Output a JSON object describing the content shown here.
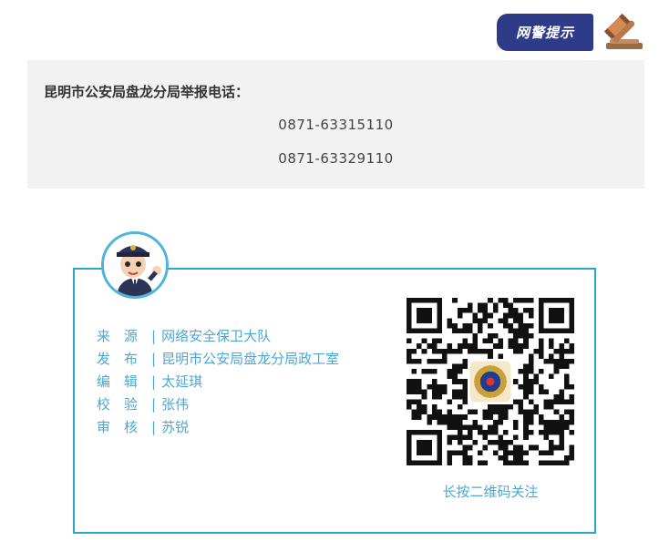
{
  "banner": {
    "label": "网警提示",
    "icon": "gavel-icon",
    "color": "#2e3b88"
  },
  "report": {
    "title": "昆明市公安局盘龙分局举报电话：",
    "phones": [
      "0871-63315110",
      "0871-63329110"
    ]
  },
  "credits": {
    "accent_color": "#29a6c8",
    "avatar": "police-cartoon-avatar",
    "separator": "|",
    "rows": [
      {
        "label": "来　源",
        "value": "网络安全保卫大队"
      },
      {
        "label": "发　布",
        "value": "昆明市公安局盘龙分局政工室"
      },
      {
        "label": "编　辑",
        "value": "太延琪"
      },
      {
        "label": "校　验",
        "value": "张伟"
      },
      {
        "label": "审　核",
        "value": "苏锐"
      }
    ]
  },
  "qr": {
    "icon": "qr-code-icon",
    "caption": "长按二维码关注"
  }
}
